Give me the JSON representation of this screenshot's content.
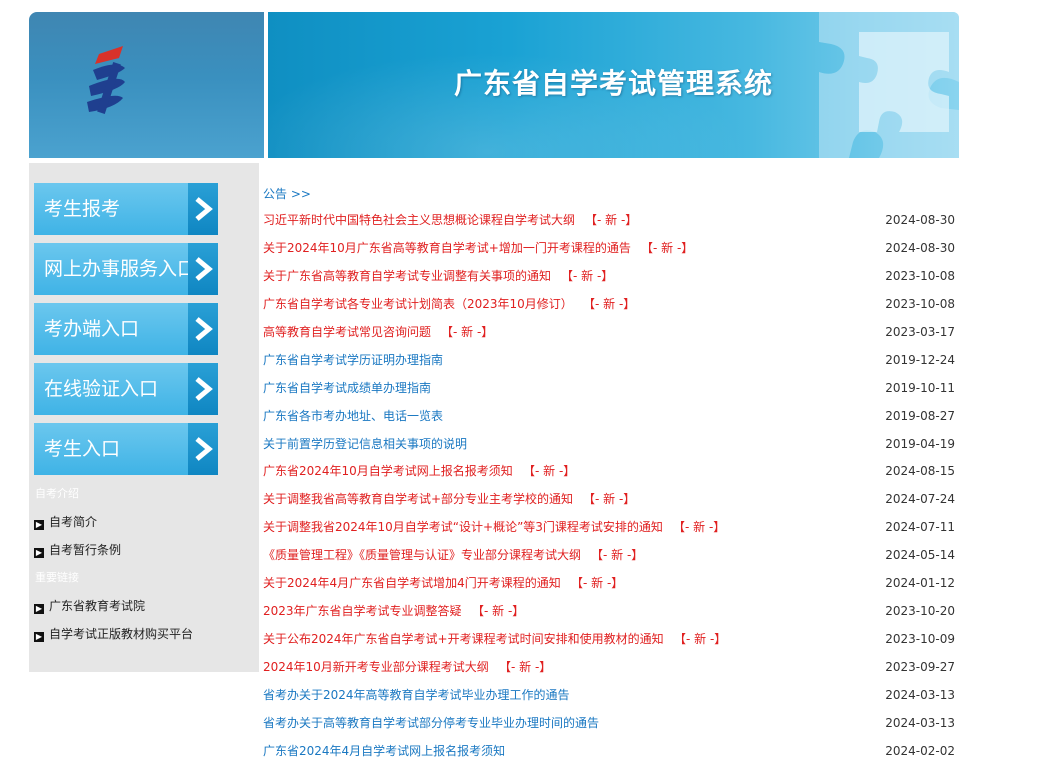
{
  "header": {
    "title": "广东省自学考试管理系统"
  },
  "sidebar": {
    "buttons": [
      {
        "label": "考生报考"
      },
      {
        "label": "网上办事服务入口"
      },
      {
        "label": "考办端入口"
      },
      {
        "label": "在线验证入口"
      },
      {
        "label": "考生入口"
      }
    ],
    "sections": [
      {
        "title": "自考介绍",
        "links": [
          "自考简介",
          "自考暂行条例"
        ]
      },
      {
        "title": "重要链接",
        "links": [
          "广东省教育考试院",
          "自学考试正版教材购买平台"
        ]
      }
    ]
  },
  "notices": {
    "heading": "公告 >>",
    "new_tag": "【- 新 -】",
    "items": [
      {
        "title": "习近平新时代中国特色社会主义思想概论课程自学考试大纲",
        "date": "2024-08-30",
        "color": "red",
        "new": true
      },
      {
        "title": "关于2024年10月广东省高等教育自学考试+增加一门开考课程的通告",
        "date": "2024-08-30",
        "color": "red",
        "new": true
      },
      {
        "title": "关于广东省高等教育自学考试专业调整有关事项的通知",
        "date": "2023-10-08",
        "color": "red",
        "new": true
      },
      {
        "title": "广东省自学考试各专业考试计划简表（2023年10月修订）",
        "date": "2023-10-08",
        "color": "red",
        "new": true
      },
      {
        "title": "高等教育自学考试常见咨询问题",
        "date": "2023-03-17",
        "color": "red",
        "new": true
      },
      {
        "title": "广东省自学考试学历证明办理指南",
        "date": "2019-12-24",
        "color": "blue",
        "new": false
      },
      {
        "title": "广东省自学考试成绩单办理指南",
        "date": "2019-10-11",
        "color": "blue",
        "new": false
      },
      {
        "title": "广东省各市考办地址、电话一览表",
        "date": "2019-08-27",
        "color": "blue",
        "new": false
      },
      {
        "title": "关于前置学历登记信息相关事项的说明",
        "date": "2019-04-19",
        "color": "blue",
        "new": false
      },
      {
        "title": "广东省2024年10月自学考试网上报名报考须知",
        "date": "2024-08-15",
        "color": "red",
        "new": true
      },
      {
        "title": "关于调整我省高等教育自学考试+部分专业主考学校的通知",
        "date": "2024-07-24",
        "color": "red",
        "new": true
      },
      {
        "title": "关于调整我省2024年10月自学考试“设计+概论”等3门课程考试安排的通知",
        "date": "2024-07-11",
        "color": "red",
        "new": true
      },
      {
        "title": "《质量管理工程》《质量管理与认证》专业部分课程考试大纲",
        "date": "2024-05-14",
        "color": "red",
        "new": true
      },
      {
        "title": "关于2024年4月广东省自学考试增加4门开考课程的通知",
        "date": "2024-01-12",
        "color": "red",
        "new": true
      },
      {
        "title": "2023年广东省自学考试专业调整答疑",
        "date": "2023-10-20",
        "color": "red",
        "new": true
      },
      {
        "title": "关于公布2024年广东省自学考试+开考课程考试时间安排和使用教材的通知",
        "date": "2023-10-09",
        "color": "red",
        "new": true
      },
      {
        "title": "2024年10月新开考专业部分课程考试大纲",
        "date": "2023-09-27",
        "color": "red",
        "new": true
      },
      {
        "title": "省考办关于2024年高等教育自学考试毕业办理工作的通告",
        "date": "2024-03-13",
        "color": "blue",
        "new": false
      },
      {
        "title": "省考办关于高等教育自学考试部分停考专业毕业办理时间的通告",
        "date": "2024-03-13",
        "color": "blue",
        "new": false
      },
      {
        "title": "广东省2024年4月自学考试网上报名报考须知",
        "date": "2024-02-02",
        "color": "blue",
        "new": false
      }
    ]
  },
  "colors": {
    "accent_red": "#e02020",
    "link_blue": "#1a78c2",
    "button_blue": "#3fb3e6",
    "sidebar_bg": "#e6e6e6"
  }
}
